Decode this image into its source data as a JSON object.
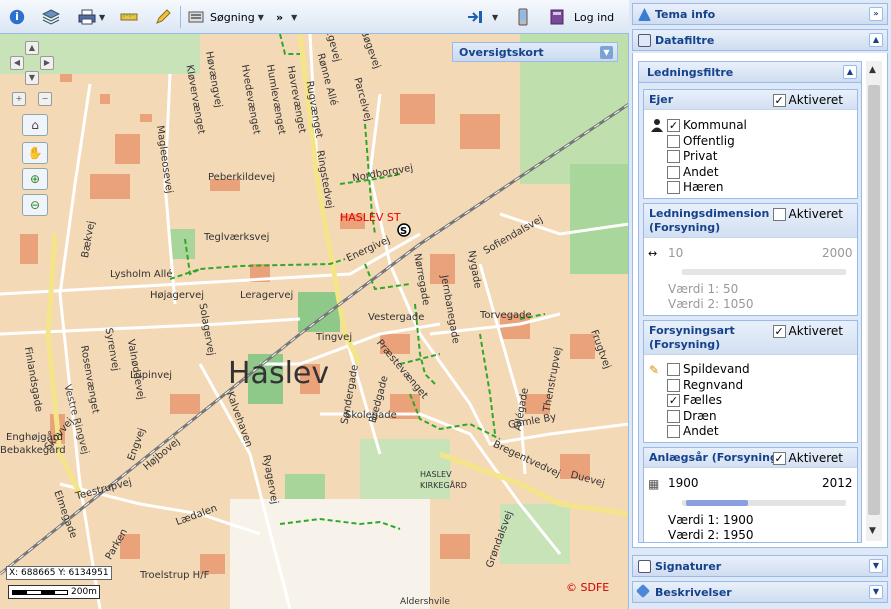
{
  "toolbar": {
    "search_label": "Søgning",
    "more_label": "»",
    "login_label": "Log ind"
  },
  "map": {
    "overview_label": "Oversigtskort",
    "coords": "X: 688665 Y: 6134951",
    "scale": "200m",
    "town_label": "Haslev",
    "station_label": "HASLEV ST",
    "cemetery_label": "HASLEV\nKIRKEGÅRD",
    "copyright": "© SDFE",
    "streets": [
      "Egevej",
      "Bøgevej",
      "Rønne Allé",
      "Parcelvej",
      "Høvængvej",
      "Kløvervænget",
      "Hvedevænget",
      "Humlevænget",
      "Havrevænget",
      "Rugvænget",
      "Magleeosevej",
      "Peberkildevej",
      "Nordborgvej",
      "Ringstedvej",
      "Sofiendalsvej",
      "Bækvej",
      "Teglværksvej",
      "Energivej",
      "Nørregade",
      "Nygade",
      "Lysholm Allé",
      "Højagervej",
      "Leragervej",
      "Jernbanegade",
      "Torvegade",
      "Solagervej",
      "Vestergade",
      "Tingvej",
      "Præstevænget",
      "Finlandsgade",
      "Rosenvænget",
      "Syrenvej",
      "Valnøddevej",
      "Lupinvej",
      "Vestre Ringvej",
      "Søndergade",
      "Bredgade",
      "Skolegade",
      "Allégade",
      "Thenstrupvej",
      "Frugtvej",
      "Kalvehaven",
      "Gamle By",
      "Engvej",
      "Ryagervej",
      "Bregentvedvej",
      "Duevej",
      "Teestrupvej",
      "Lædalen",
      "Grøndalsvej",
      "Troelstrup H/F",
      "Enghøjgård",
      "Bebakkegård",
      "Elmegade",
      "Højbovej",
      "Skovvej",
      "Parken",
      "Aldershvile"
    ]
  },
  "panels": {
    "tema_info": "Tema info",
    "datafiltre": "Datafiltre",
    "signaturer": "Signaturer",
    "beskrivelser": "Beskrivelser"
  },
  "ledningsfiltre": {
    "title": "Ledningsfiltre",
    "activated_label": "Aktiveret",
    "ejer": {
      "title": "Ejer",
      "activated": true,
      "options": [
        {
          "label": "Kommunal",
          "checked": true
        },
        {
          "label": "Offentlig",
          "checked": false
        },
        {
          "label": "Privat",
          "checked": false
        },
        {
          "label": "Andet",
          "checked": false
        },
        {
          "label": "Hæren",
          "checked": false
        }
      ]
    },
    "dimension": {
      "title": "Ledningsdimension (Forsyning)",
      "activated": false,
      "min": "10",
      "max": "2000",
      "v1": "Værdi 1: 50",
      "v2": "Værdi 2: 1050"
    },
    "forsyningsart": {
      "title": "Forsyningsart (Forsyning)",
      "activated": true,
      "options": [
        {
          "label": "Spildevand",
          "checked": false
        },
        {
          "label": "Regnvand",
          "checked": false
        },
        {
          "label": "Fælles",
          "checked": true
        },
        {
          "label": "Dræn",
          "checked": false
        },
        {
          "label": "Andet",
          "checked": false
        }
      ]
    },
    "anlaegsaar": {
      "title": "Anlægsår (Forsyning)",
      "activated": true,
      "min": "1900",
      "max": "2012",
      "v1": "Værdi 1: 1900",
      "v2": "Værdi 2: 1950"
    }
  }
}
